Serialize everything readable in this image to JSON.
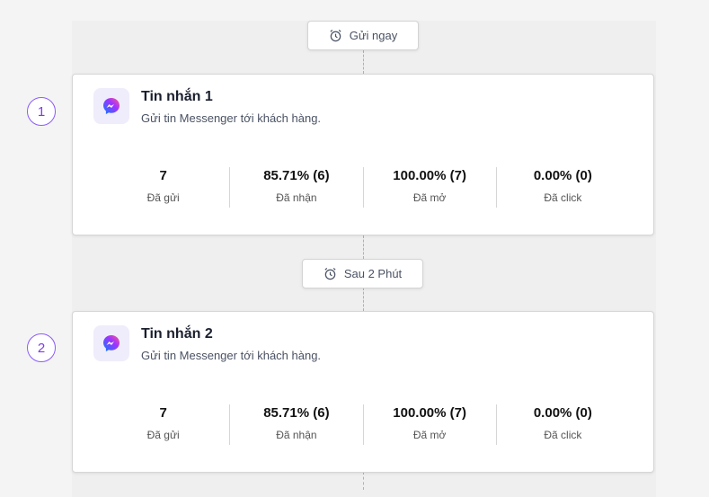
{
  "delays": [
    "Gửi ngay",
    "Sau 2 Phút"
  ],
  "steps": [
    {
      "number": "1",
      "title": "Tin nhắn 1",
      "subtitle": "Gửi tin Messenger tới khách hàng.",
      "stats": [
        {
          "value": "7",
          "label": "Đã gửi"
        },
        {
          "value": "85.71% (6)",
          "label": "Đã nhận"
        },
        {
          "value": "100.00% (7)",
          "label": "Đã mở"
        },
        {
          "value": "0.00% (0)",
          "label": "Đã click"
        }
      ]
    },
    {
      "number": "2",
      "title": "Tin nhắn 2",
      "subtitle": "Gửi tin Messenger tới khách hàng.",
      "stats": [
        {
          "value": "7",
          "label": "Đã gửi"
        },
        {
          "value": "85.71% (6)",
          "label": "Đã nhận"
        },
        {
          "value": "100.00% (7)",
          "label": "Đã mở"
        },
        {
          "value": "0.00% (0)",
          "label": "Đã click"
        }
      ]
    }
  ],
  "colors": {
    "accent": "#7c3aed"
  }
}
